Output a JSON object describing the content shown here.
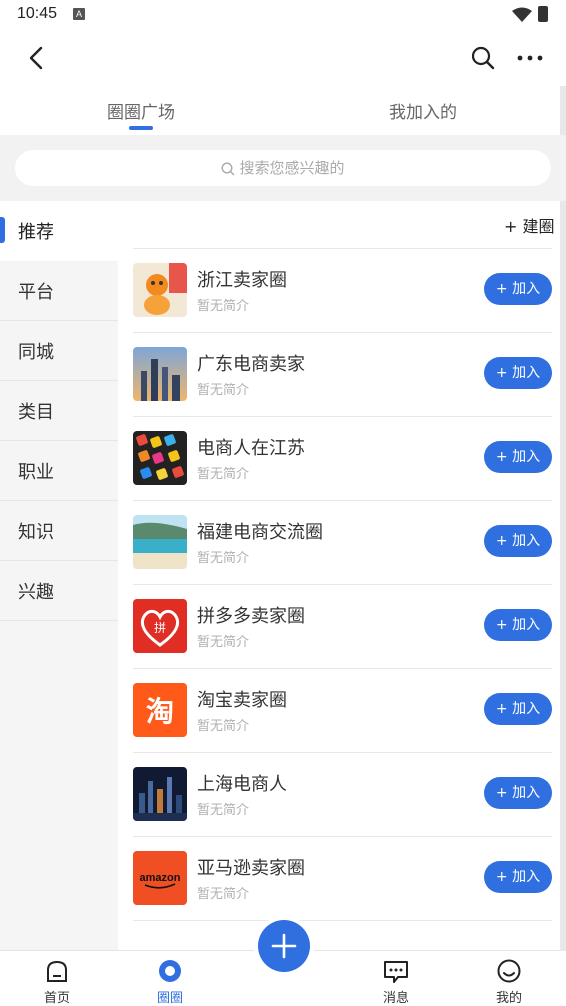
{
  "status": {
    "time": "10:45",
    "a_label": "A"
  },
  "tabs": [
    {
      "label": "圈圈广场"
    },
    {
      "label": "我加入的"
    }
  ],
  "search": {
    "placeholder": "搜索您感兴趣的"
  },
  "sidebar": {
    "items": [
      {
        "label": "推荐"
      },
      {
        "label": "平台"
      },
      {
        "label": "同城"
      },
      {
        "label": "类目"
      },
      {
        "label": "职业"
      },
      {
        "label": "知识"
      },
      {
        "label": "兴趣"
      }
    ]
  },
  "create_label": "+ 建圈",
  "circles": [
    {
      "name": "浙江卖家圈",
      "desc": "暂无简介",
      "join": "+ 加入"
    },
    {
      "name": "广东电商卖家",
      "desc": "暂无简介",
      "join": "+ 加入"
    },
    {
      "name": "电商人在江苏",
      "desc": "暂无简介",
      "join": "+ 加入"
    },
    {
      "name": "福建电商交流圈",
      "desc": "暂无简介",
      "join": "+ 加入"
    },
    {
      "name": "拼多多卖家圈",
      "desc": "暂无简介",
      "join": "+ 加入"
    },
    {
      "name": "淘宝卖家圈",
      "desc": "暂无简介",
      "join": "+ 加入"
    },
    {
      "name": "上海电商人",
      "desc": "暂无简介",
      "join": "+ 加入"
    },
    {
      "name": "亚马逊卖家圈",
      "desc": "暂无简介",
      "join": "+ 加入"
    }
  ],
  "thumbs": {
    "taobao_glyph": "淘",
    "amazon_text": "amazon",
    "pdd_text": "拼"
  },
  "bottom_nav": [
    {
      "label": "首页"
    },
    {
      "label": "圈圈"
    },
    {
      "label": "消息"
    },
    {
      "label": "我的"
    }
  ],
  "colors": {
    "accent": "#2f6fe0"
  }
}
